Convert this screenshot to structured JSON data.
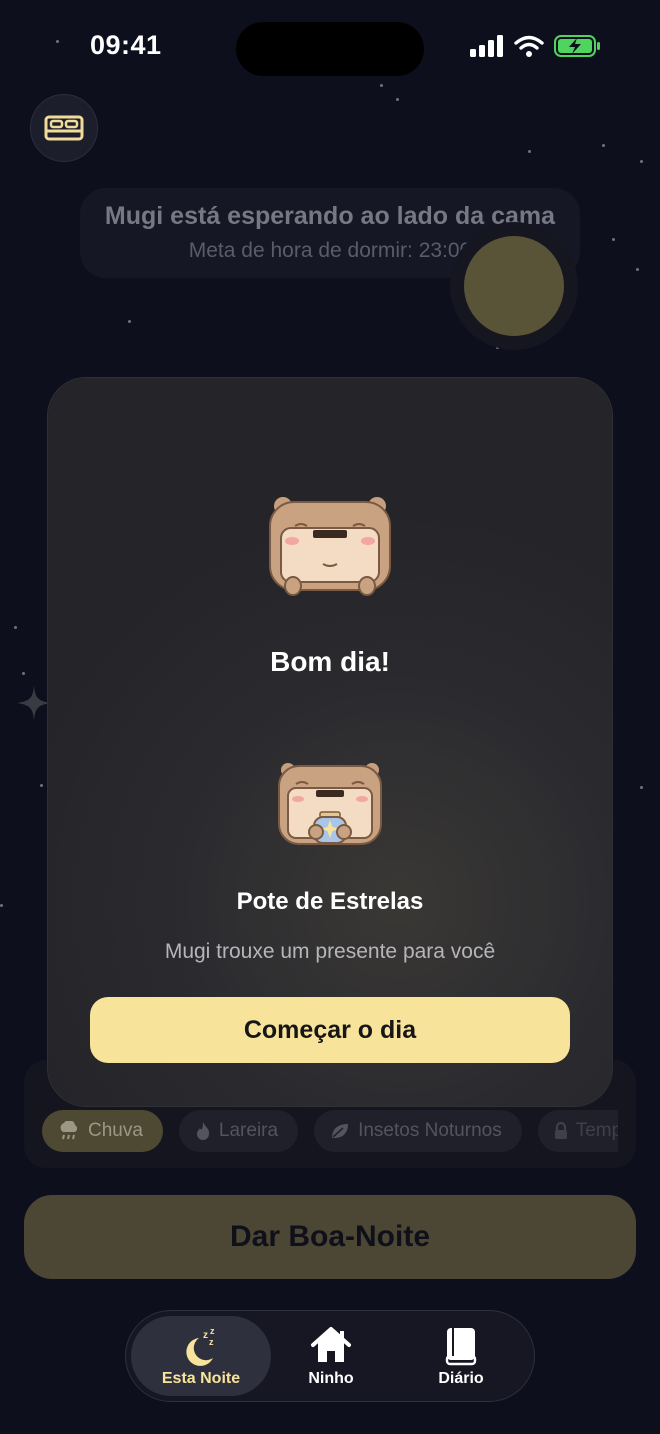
{
  "status_bar": {
    "time": "09:41"
  },
  "wait_card": {
    "title": "Mugi está esperando ao lado da cama",
    "subtitle": "Meta de hora de dormir: 23:00"
  },
  "sounds": [
    {
      "label": "Chuva",
      "icon": "rain-cloud-icon",
      "active": true
    },
    {
      "label": "Lareira",
      "icon": "flame-icon",
      "active": false
    },
    {
      "label": "Insetos Noturnos",
      "icon": "leaf-icon",
      "active": false
    },
    {
      "label": "Tempes",
      "icon": "lock-icon",
      "active": false
    }
  ],
  "goodnight_button": {
    "label": "Dar Boa-Noite"
  },
  "tabs": [
    {
      "label": "Esta Noite",
      "icon": "moon-zzz-icon",
      "active": true
    },
    {
      "label": "Ninho",
      "icon": "home-icon",
      "active": false
    },
    {
      "label": "Diário",
      "icon": "book-icon",
      "active": false
    }
  ],
  "modal": {
    "greeting": "Bom dia!",
    "gift_title": "Pote de Estrelas",
    "gift_subtitle": "Mugi trouxe um presente para você",
    "start_button": "Começar o dia"
  },
  "colors": {
    "background": "#0d0f1d",
    "accent": "#f8e39b",
    "moon": "#595437",
    "active_chip": "#4e4932"
  }
}
